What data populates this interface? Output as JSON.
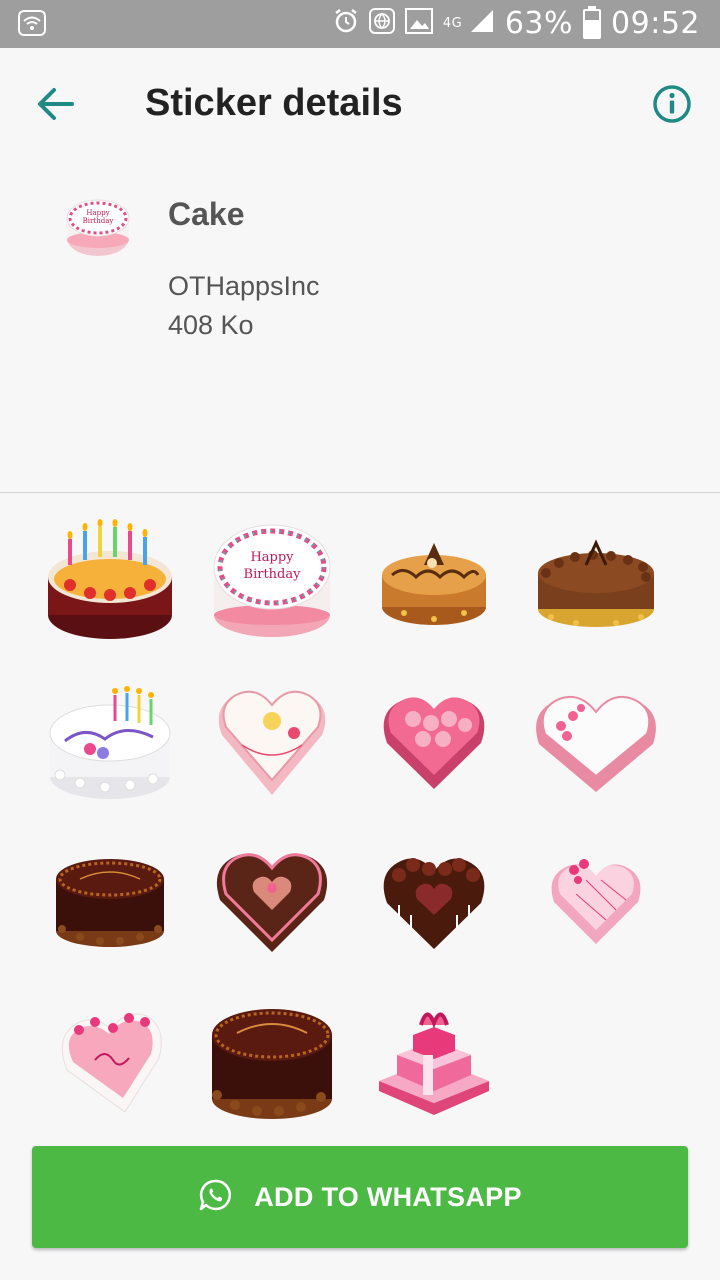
{
  "status_bar": {
    "network_type": "4G",
    "battery_level": "63%",
    "time": "09:52",
    "icons": [
      "wifi-icon",
      "alarm-icon",
      "globe-icon",
      "image-icon",
      "signal-icon",
      "battery-icon"
    ]
  },
  "app_bar": {
    "title": "Sticker details",
    "back_icon": "arrow-left-icon",
    "info_icon": "info-icon"
  },
  "pack": {
    "name": "Cake",
    "publisher": "OTHappsInc",
    "size": "408 Ko",
    "tray_text": [
      "Happy",
      "Birthday"
    ]
  },
  "stickers": [
    {
      "name": "candle-cake-sticker"
    },
    {
      "name": "happy-birthday-cake-sticker",
      "text": [
        "Happy",
        "Birthday"
      ]
    },
    {
      "name": "caramel-cake-sticker"
    },
    {
      "name": "chocolate-nut-cake-sticker"
    },
    {
      "name": "birthday-cake-with-candles-sticker"
    },
    {
      "name": "white-heart-cake-sticker"
    },
    {
      "name": "pink-rose-heart-cake-sticker"
    },
    {
      "name": "pink-white-heart-cake-sticker"
    },
    {
      "name": "chocolate-birthday-cake-sticker"
    },
    {
      "name": "chocolate-heart-cake-sticker"
    },
    {
      "name": "chocolate-rose-heart-cake-sticker"
    },
    {
      "name": "small-pink-heart-cake-sticker"
    },
    {
      "name": "love-heart-cake-sticker"
    },
    {
      "name": "large-chocolate-birthday-cake-sticker"
    },
    {
      "name": "pink-gift-cake-sticker"
    }
  ],
  "action": {
    "label": "ADD TO WHATSAPP",
    "icon": "whatsapp-icon"
  },
  "colors": {
    "accent": "#1f8a84",
    "button_green": "#4cb944",
    "status_bar": "#9e9e9e"
  }
}
